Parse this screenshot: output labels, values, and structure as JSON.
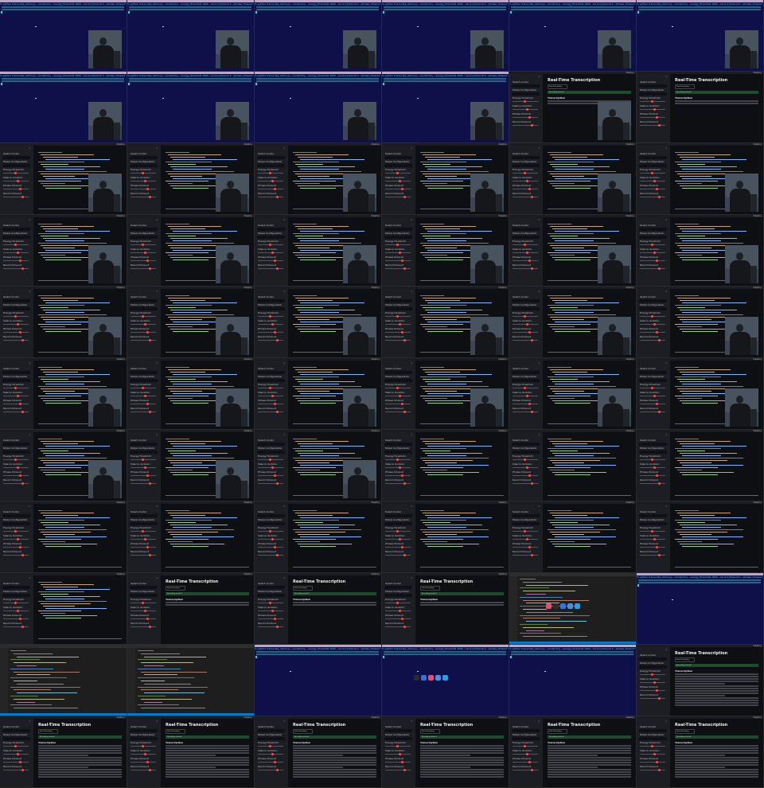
{
  "app": {
    "title": "Real-Time Transcription",
    "start_button": "Start Recording",
    "status_text": "Recording started!",
    "section_heading": "Transcription",
    "deploy_label": "Deploy",
    "close_glyph": "×"
  },
  "sidebar": {
    "labels": [
      "Select model",
      "Model Configuration",
      "Energy threshold",
      "Silence duration",
      "Phrase timeout",
      "Record timeout"
    ],
    "model_value": "tiny",
    "config_value": "Recommended configuration"
  },
  "terminal": {
    "prompt_text": "% python transcribe_demo.py --model tiny --energy_threshold 1000 --record_timeout 2 --phrase_timeout 3"
  },
  "colors": {
    "terminal_bg": "#0f0f4a",
    "app_bg": "#0e0f13",
    "sidebar_bg": "#1c1e24",
    "status_green": "#1f4a30",
    "accent_red": "#ff4b4b",
    "editor_status_blue": "#007acc"
  },
  "frames": [
    "term-cam",
    "term-cam",
    "term-cam",
    "term-cam",
    "term-cam",
    "term-cam",
    "term-cam",
    "term-cam",
    "term-cam",
    "term-cam",
    "app-title-cam",
    "app-title",
    "app-code-cam",
    "app-code-cam",
    "app-code-cam",
    "app-code-cam",
    "app-code-cam",
    "app-code-cam",
    "app-code-cam",
    "app-code-cam",
    "app-code-cam",
    "app-code-cam",
    "app-code-cam",
    "app-code-cam",
    "app-code-cam",
    "app-code-cam",
    "app-code-cam",
    "app-code-cam",
    "app-code-cam",
    "app-code-cam",
    "app-code-cam",
    "app-code-cam",
    "app-code-cam",
    "app-code-cam",
    "app-code-cam",
    "app-code-cam",
    "app-code-cam",
    "app-code-cam",
    "app-code-cam",
    "app-code",
    "app-code",
    "app-code",
    "app-code",
    "app-code",
    "app-code",
    "app-code",
    "app-code",
    "app-code",
    "app-code",
    "app-title",
    "app-title",
    "app-title",
    "editor-dock",
    "term",
    "editor",
    "editor",
    "term",
    "term-dock",
    "term",
    "app-title-text",
    "app-title-text",
    "app-title-text",
    "app-title-text",
    "app-title-text",
    "app-title-text",
    "app-title-text"
  ]
}
